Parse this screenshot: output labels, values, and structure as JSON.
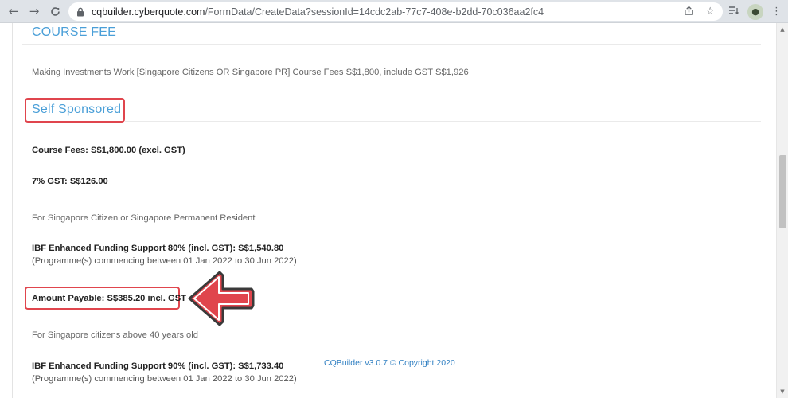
{
  "browser": {
    "url_host": "cqbuilder.cyberquote.com",
    "url_path": "/FormData/CreateData?sessionId=14cdc2ab-77c7-408e-b2dd-70c036aa2fc4"
  },
  "course_fee": {
    "heading": "COURSE FEE",
    "description": "Making Investments Work [Singapore Citizens OR Singapore PR] Course Fees S$1,800, include GST S$1,926"
  },
  "self_sponsored": {
    "heading": "Self Sponsored",
    "course_fees": "Course Fees: S$1,800.00 (excl. GST)",
    "gst": "7% GST: S$126.00",
    "group1_label": "For Singapore Citizen or Singapore Permanent Resident",
    "funding1": "IBF Enhanced Funding Support 80% (incl. GST): S$1,540.80",
    "funding1_note": "(Programme(s) commencing between 01 Jan 2022 to 30 Jun 2022)",
    "amount_payable": "Amount Payable: S$385.20 incl. GST",
    "group2_label": "For Singapore citizens above 40 years old",
    "funding2": "IBF Enhanced Funding Support 90% (incl. GST): S$1,733.40",
    "funding2_note": "(Programme(s) commencing between 01 Jan 2022 to 30 Jun 2022)"
  },
  "footer": {
    "copyright": "CQBuilder v3.0.7 © Copyright 2020"
  },
  "colors": {
    "accent": "#4a9fd8",
    "highlight": "#e0454d"
  }
}
